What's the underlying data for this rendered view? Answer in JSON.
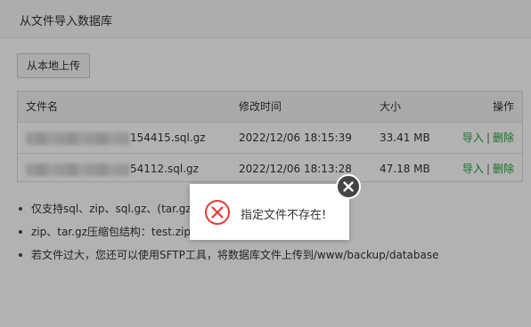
{
  "dialog": {
    "title": "从文件导入数据库",
    "upload_button": "从本地上传"
  },
  "table": {
    "headers": [
      "文件名",
      "修改时间",
      "大小",
      "操作"
    ],
    "rows": [
      {
        "name": "154415.sql.gz",
        "time": "2022/12/06 18:15:39",
        "size": "33.41 MB",
        "import": "导入",
        "sep": "|",
        "delete": "删除"
      },
      {
        "name": "54112.sql.gz",
        "time": "2022/12/06 18:13:28",
        "size": "47.18 MB",
        "import": "导入",
        "sep": "|",
        "delete": "删除"
      }
    ]
  },
  "notes": [
    "仅支持sql、zip、sql.gz、(tar.gz|",
    "zip、tar.gz压缩包结构：test.zip或",
    "若文件过大，您还可以使用SFTP工具，将数据库文件上传到/www/backup/database"
  ],
  "toast": {
    "message": "指定文件不存在!",
    "icon": "error-circle-x-icon",
    "close_icon": "close-circle-icon"
  },
  "colors": {
    "accent": "#20a53a",
    "error": "#e53935",
    "overlay": "rgba(0,0,0,0.3)"
  }
}
